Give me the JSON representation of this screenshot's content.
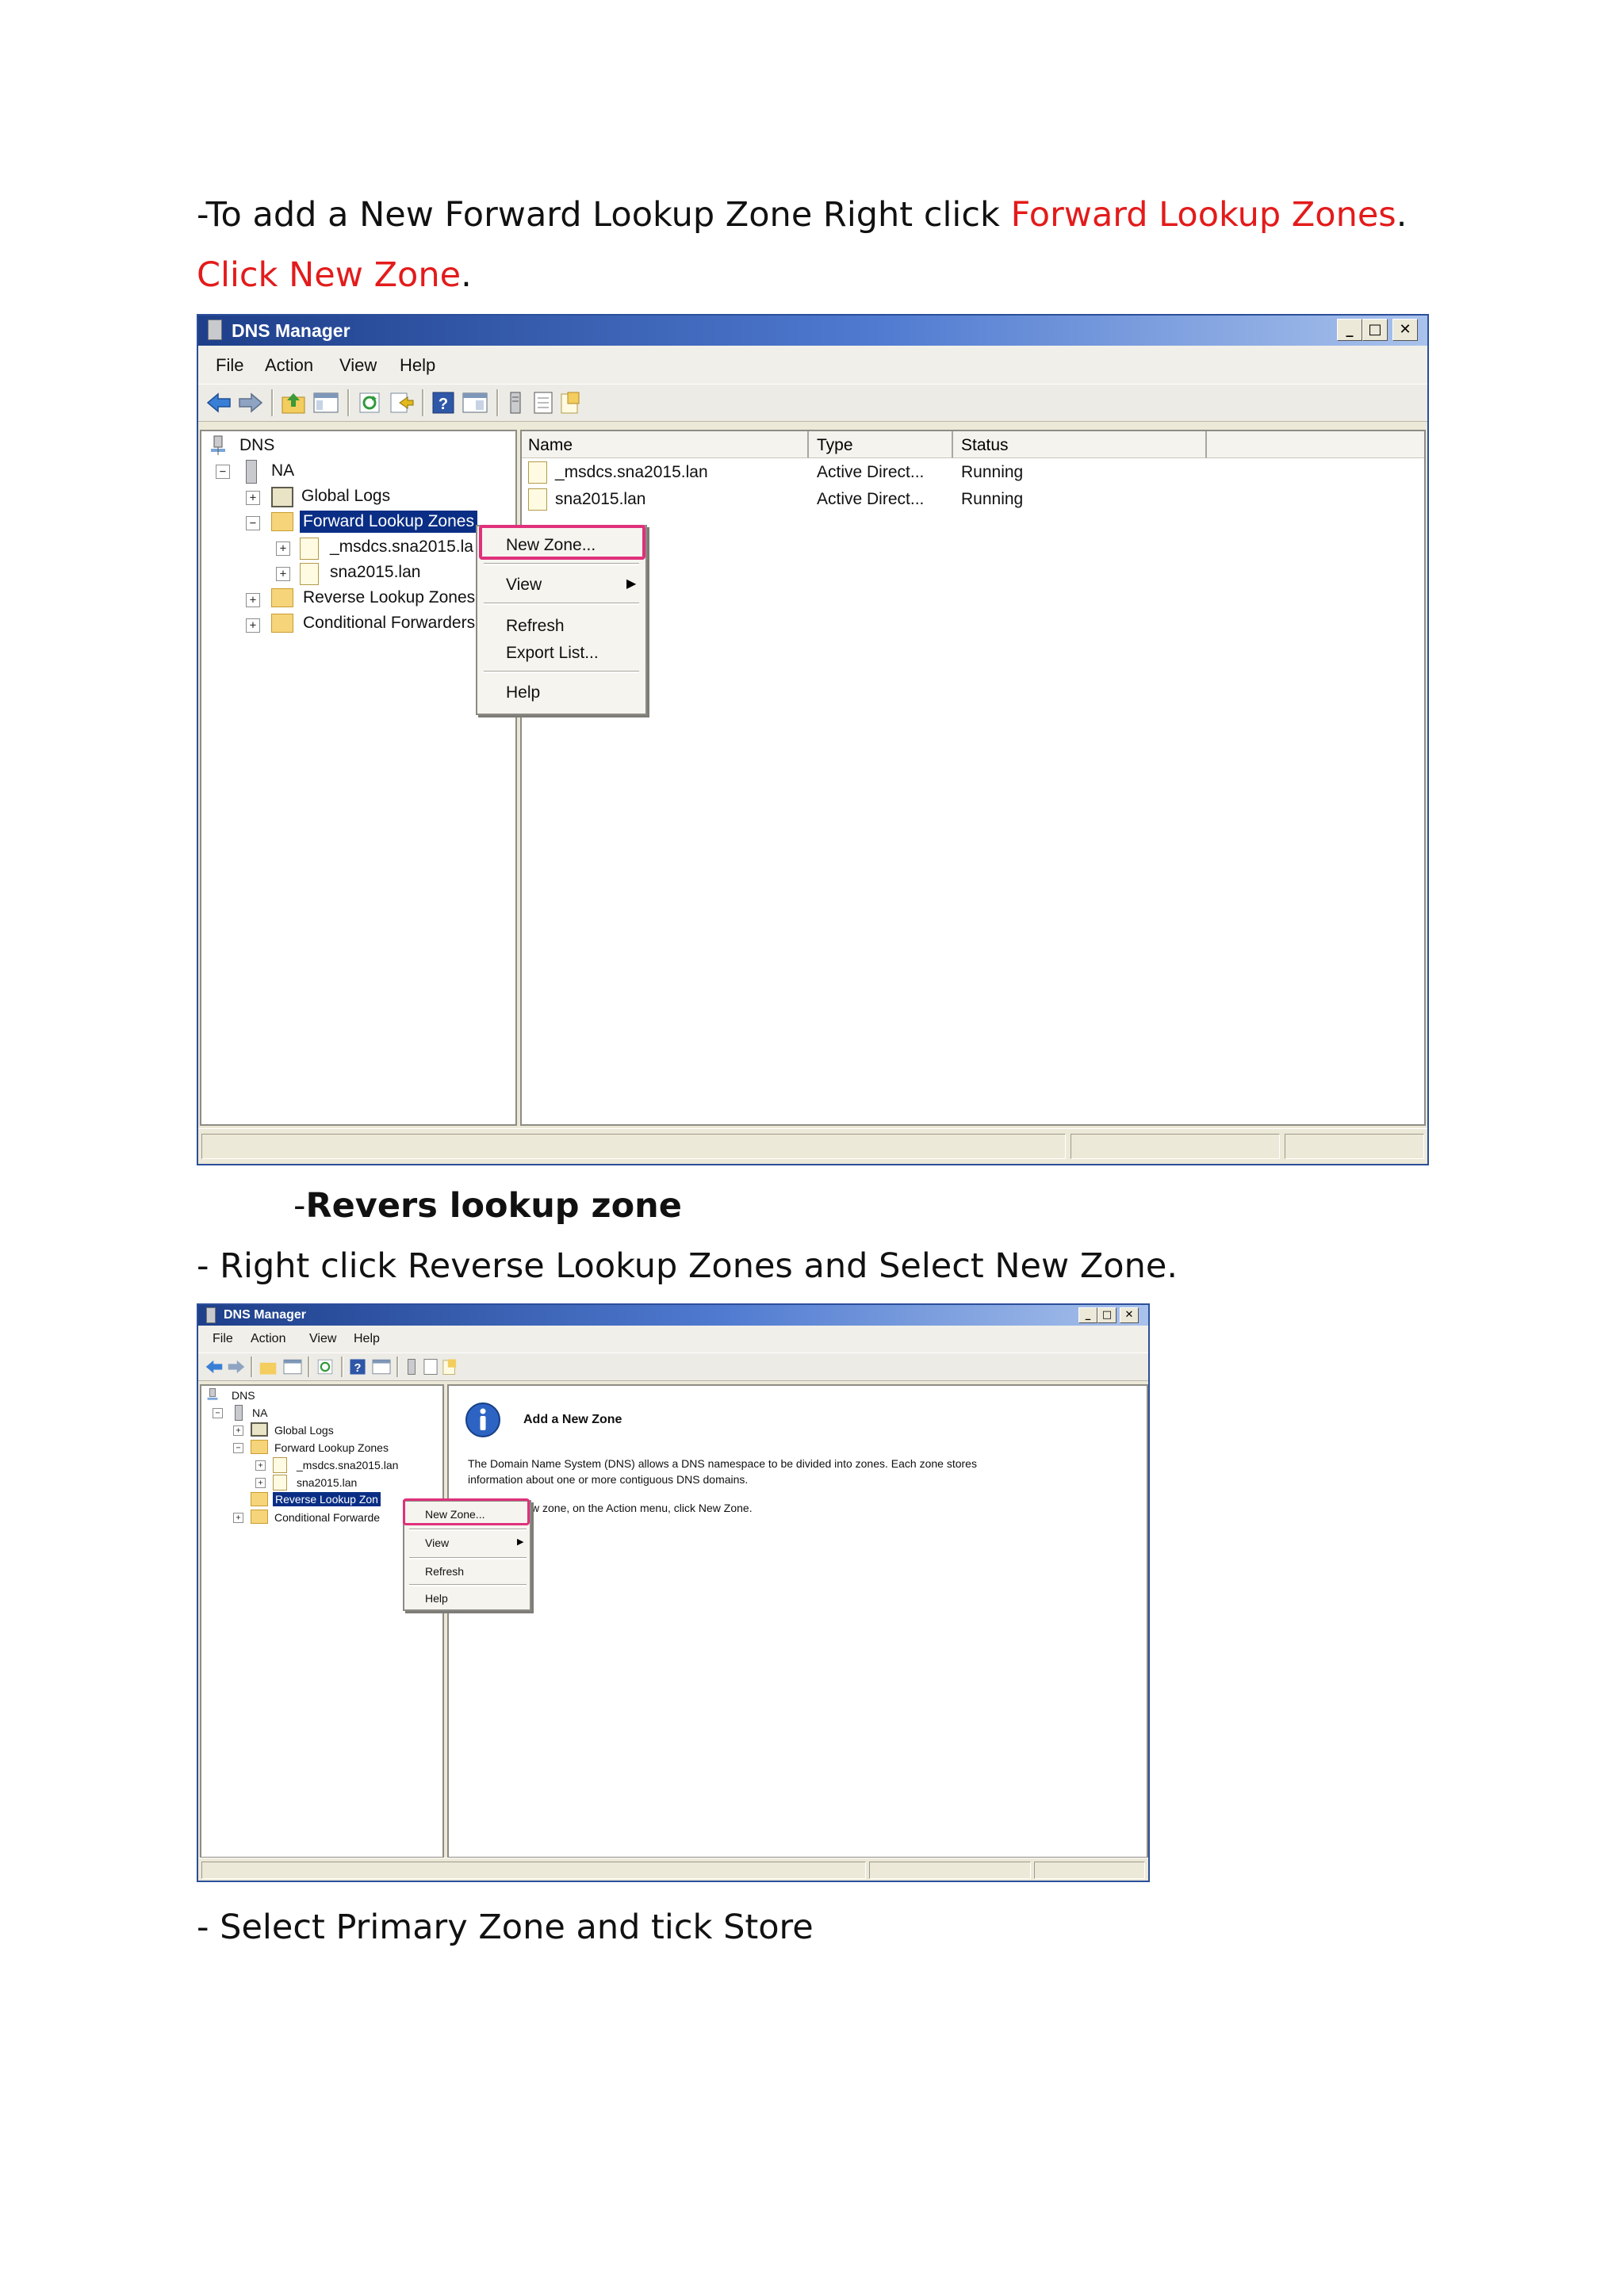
{
  "section1": {
    "line1_prefix": "-To add a New Forward Lookup Zone Right click ",
    "line1_highlight": "Forward Lookup Zones",
    "line1_suffix": ".",
    "line2_highlight": "Click New Zone",
    "line2_suffix": "."
  },
  "window1": {
    "title": "DNS Manager",
    "controls": [
      "_",
      "□",
      "✕"
    ],
    "menu": [
      "File",
      "Action",
      "View",
      "Help"
    ],
    "tree": {
      "root": "DNS",
      "server": "NA",
      "global_logs": "Global Logs",
      "forward_zones": "Forward Lookup Zones",
      "child1": "_msdcs.sna2015.la",
      "child2": "sna2015.lan",
      "reverse_zones": "Reverse Lookup Zones",
      "conditional": "Conditional Forwarders"
    },
    "columns": [
      "Name",
      "Type",
      "Status"
    ],
    "rows": [
      {
        "name": "_msdcs.sna2015.lan",
        "type": "Active Direct...",
        "status": "Running"
      },
      {
        "name": "sna2015.lan",
        "type": "Active Direct...",
        "status": "Running"
      }
    ],
    "context_menu": {
      "new_zone": "New Zone...",
      "view": "View",
      "refresh": "Refresh",
      "export": "Export List...",
      "help": "Help"
    }
  },
  "section2": {
    "heading_prefix": "-",
    "heading": "Revers lookup  zone",
    "instruction": "- Right click Reverse Lookup Zones and Select New Zone."
  },
  "window2": {
    "title": "DNS Manager",
    "controls": [
      "_",
      "□",
      "✕"
    ],
    "menu": [
      "File",
      "Action",
      "View",
      "Help"
    ],
    "tree": {
      "root": "DNS",
      "server": "NA",
      "global_logs": "Global Logs",
      "forward_zones": "Forward Lookup Zones",
      "child1": "_msdcs.sna2015.lan",
      "child2": "sna2015.lan",
      "reverse_zones": "Reverse Lookup Zon",
      "conditional": "Conditional Forwarde"
    },
    "info": {
      "heading": "Add a New Zone",
      "body_line1": "The Domain Name System (DNS) allows a DNS namespace to be divided into zones. Each zone stores",
      "body_line2": "information about one or more contiguous DNS domains.",
      "body_line3": "w zone, on the Action menu, click New Zone."
    },
    "context_menu": {
      "new_zone": "New Zone...",
      "view": "View",
      "refresh": "Refresh",
      "help": "Help"
    }
  },
  "section3": {
    "instruction": "-  Select Primary Zone and tick Store"
  },
  "colors": {
    "highlight_text": "#e31b1b",
    "highlight_box": "#e0317b",
    "selection": "#0a2e85",
    "title_bar": "#1e3f8a"
  },
  "icons": [
    "back-arrow-icon",
    "forward-arrow-icon",
    "up-folder-icon",
    "show-tree-icon",
    "refresh-icon",
    "export-icon",
    "help-icon",
    "properties-icon",
    "server-icon",
    "list-icon",
    "zone-file-icon",
    "folder-icon",
    "info-icon"
  ]
}
